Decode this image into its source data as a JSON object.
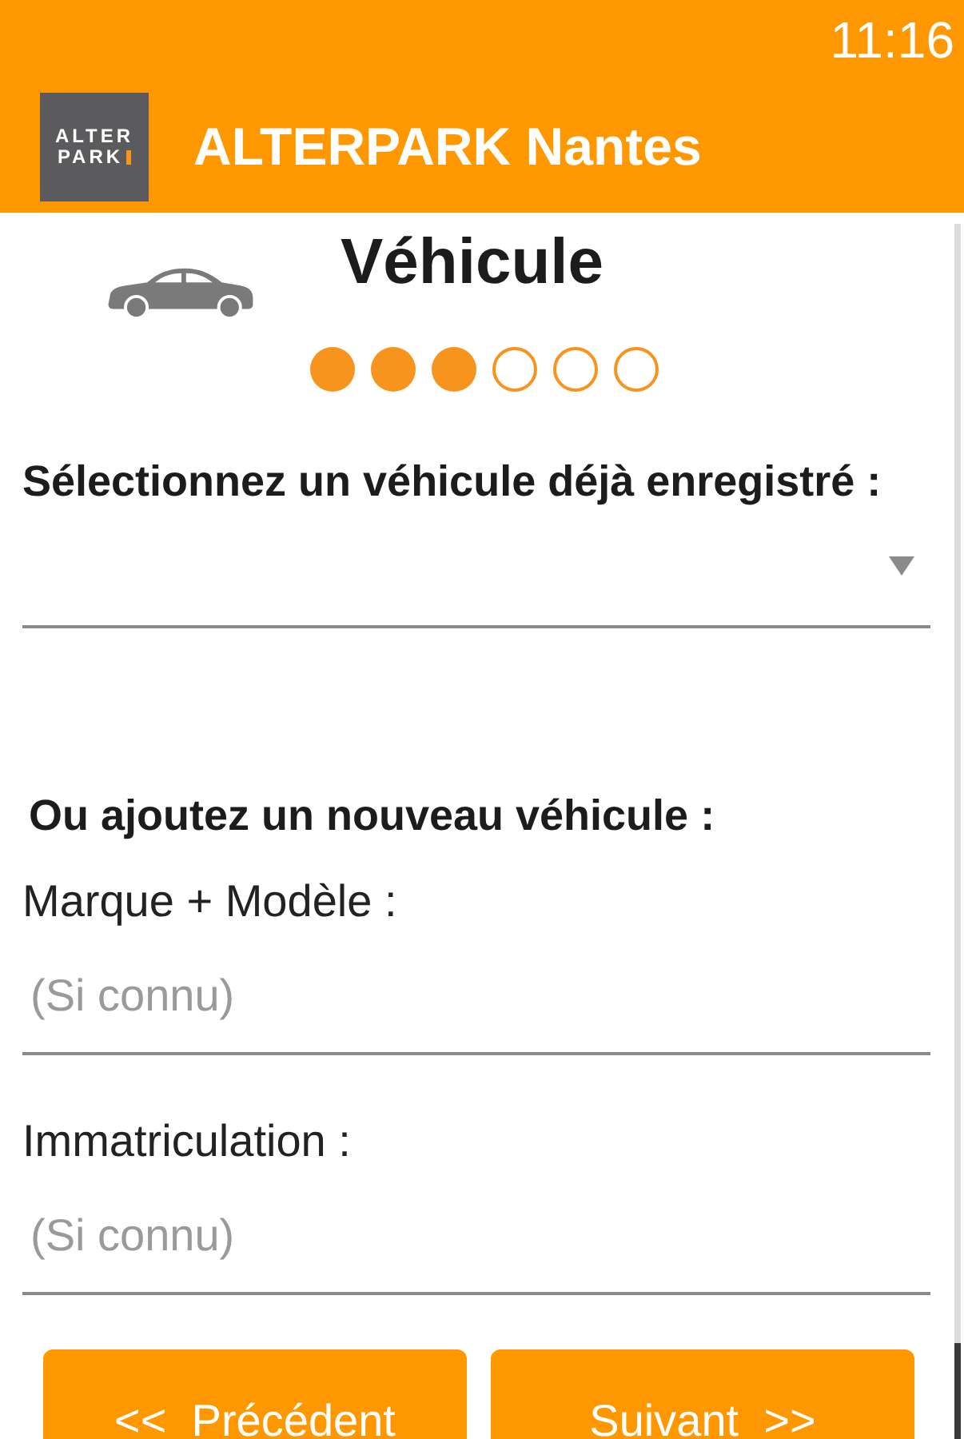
{
  "status_bar": {
    "time": "11:16"
  },
  "app_bar": {
    "logo": {
      "lines": [
        "ALTER",
        "PARK"
      ]
    },
    "title": "ALTERPARK Nantes"
  },
  "header": {
    "title": "Véhicule",
    "steps": [
      {
        "completed": true
      },
      {
        "completed": true
      },
      {
        "completed": true
      },
      {
        "completed": false
      },
      {
        "completed": false
      },
      {
        "completed": false
      }
    ]
  },
  "saved_vehicle": {
    "label": "Sélectionnez un véhicule déjà enregistré :"
  },
  "new_vehicle": {
    "heading": "Ou ajoutez un nouveau véhicule :",
    "fields": [
      {
        "label": "Marque + Modèle :",
        "placeholder": "(Si connu)"
      },
      {
        "label": "Immatriculation :",
        "placeholder": "(Si connu)"
      }
    ]
  },
  "buttons": [
    {
      "label": "<<  Précédent"
    },
    {
      "label": "Suivant  >>"
    }
  ]
}
